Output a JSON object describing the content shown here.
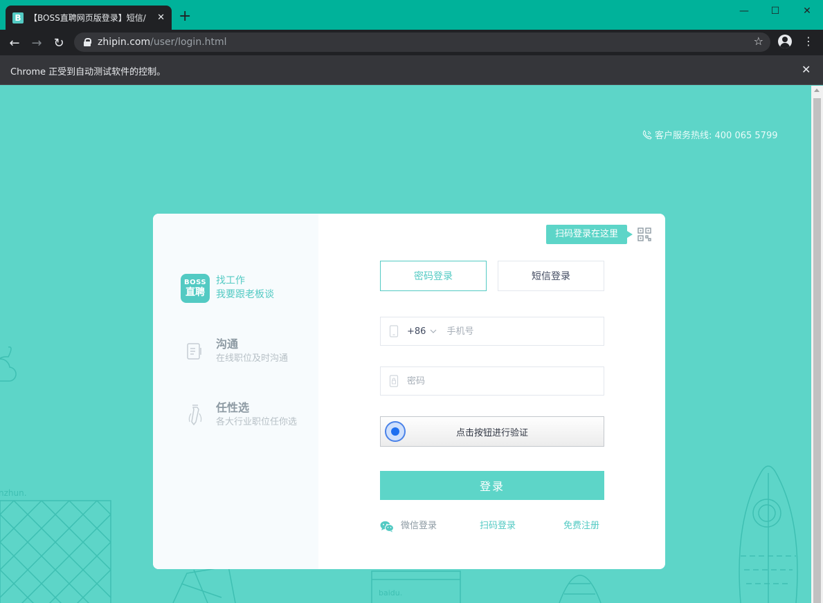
{
  "browser": {
    "tab_title": "【BOSS直聘网页版登录】短信/",
    "tab_favicon": "B",
    "tab_close": "✕",
    "new_tab": "+",
    "minimize": "—",
    "maximize": "☐",
    "close": "✕",
    "back": "←",
    "forward": "→",
    "reload": "↻",
    "url_host": "zhipin.com",
    "url_path": "/user/login.html",
    "bookmark_star": "☆",
    "menu": "⋮",
    "infobar_text": "Chrome 正受到自动测试软件的控制。",
    "infobar_close": "✕"
  },
  "header": {
    "hotline": "客户服务热线: 400 065 5799"
  },
  "side": {
    "logo_line1": "BOSS",
    "logo_line2": "直聘",
    "features": [
      {
        "title": "找工作",
        "sub": "我要跟老板谈"
      },
      {
        "title": "沟通",
        "sub": "在线职位及时沟通"
      },
      {
        "title": "任性选",
        "sub": "各大行业职位任你选"
      }
    ]
  },
  "login": {
    "qr_tip": "扫码登录在这里",
    "tabs": [
      {
        "label": "密码登录",
        "active": true
      },
      {
        "label": "短信登录",
        "active": false
      }
    ],
    "country_code": "+86",
    "phone_placeholder": "手机号",
    "password_placeholder": "密码",
    "verify_label": "点击按钮进行验证",
    "submit_label": "登录",
    "links": {
      "wechat": "微信登录",
      "scan": "扫码登录",
      "register": "免费注册"
    }
  },
  "background_text": {
    "left": "nzhun.",
    "bottom": "baidu."
  },
  "colors": {
    "brand": "#53cac3",
    "page_bg": "#5dd5c8",
    "tab_bar": "#00b29a",
    "link_grey": "#8d9aa3"
  }
}
